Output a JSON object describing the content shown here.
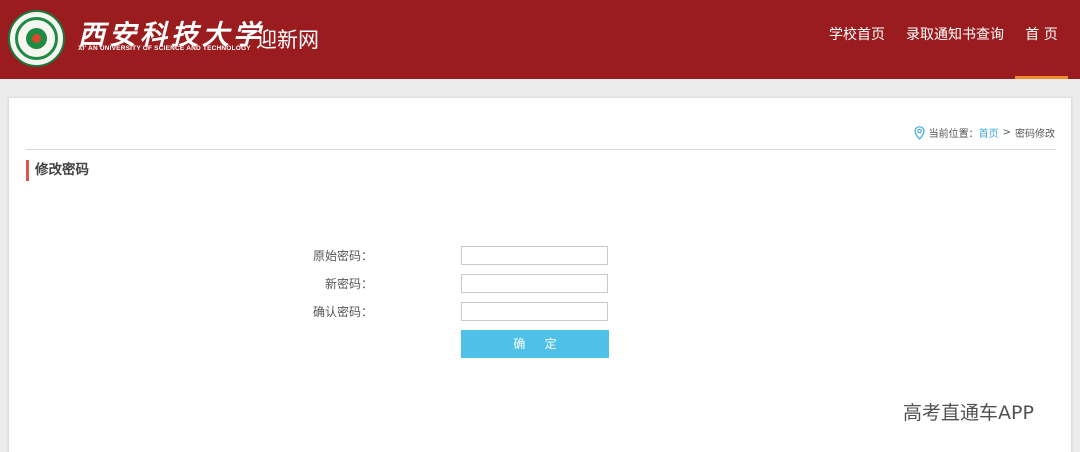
{
  "header": {
    "logo_cn": "西安科技大学",
    "logo_en": "XI' AN UNIVERSITY OF SCIENCE AND TECHNOLOGY",
    "portal_name": "迎新网",
    "brand_color": "#9b1c1f",
    "active_indicator_color": "#f08a2c"
  },
  "nav": {
    "items": [
      {
        "label": "学校首页"
      },
      {
        "label": "录取通知书查询"
      },
      {
        "label": "首 页",
        "active": true
      }
    ]
  },
  "breadcrumb": {
    "icon": "location-pin-icon",
    "prefix": "当前位置：",
    "home": "首页",
    "separator": ">",
    "current": "密码修改"
  },
  "section": {
    "title": "修改密码",
    "accent_color": "#d9534f"
  },
  "form": {
    "old_password_label": "原始密码：",
    "old_password_value": "",
    "new_password_label": "新密码：",
    "new_password_value": "",
    "confirm_password_label": "确认密码：",
    "confirm_password_value": "",
    "submit_label": "确 定",
    "submit_color": "#4fc1e9"
  },
  "watermark": "高考直通车APP"
}
